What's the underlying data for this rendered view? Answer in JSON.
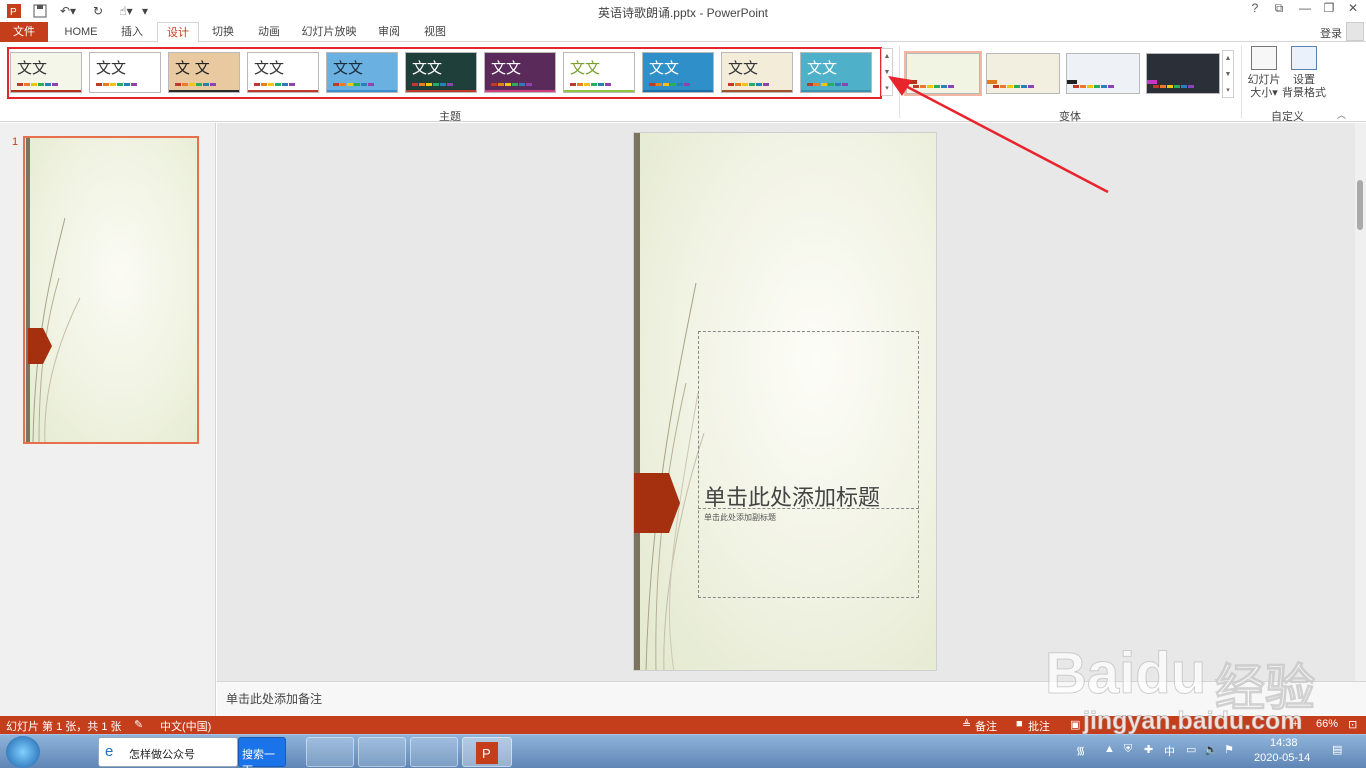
{
  "window": {
    "title": "英语诗歌朗诵.pptx - PowerPoint",
    "help": "?",
    "controls": [
      "?",
      "⧉",
      "—",
      "❐",
      "✕"
    ]
  },
  "quick_access": {
    "save_icon": "save-icon",
    "undo_icon": "undo-icon",
    "redo_icon": "redo-icon",
    "touch_icon": "touch-mode-icon"
  },
  "tabs": {
    "file": "文件",
    "items": [
      "HOME",
      "插入",
      "设计",
      "切换",
      "动画",
      "幻灯片放映",
      "审阅",
      "视图"
    ],
    "active": "设计",
    "login": "登录"
  },
  "ribbon": {
    "themes_group_label": "主题",
    "variants_group_label": "变体",
    "customize_group_label": "自定义",
    "theme_text": "文文",
    "theme_alt_text": "文 文",
    "slide_size_label": "幻灯片大小",
    "slide_size_line1": "幻灯片",
    "slide_size_line2": "大小",
    "bg_format_line1": "设置",
    "bg_format_line2": "背景格式",
    "themes": [
      {
        "bg": "#f4f6ea",
        "fg": "#333333",
        "bar": "#b5321a"
      },
      {
        "bg": "#ffffff",
        "fg": "#333333",
        "bar": "#ffffff"
      },
      {
        "bg": "#e9c9a0",
        "fg": "#222222",
        "bar": "#2b2b2b"
      },
      {
        "bg": "#ffffff",
        "fg": "#333333",
        "bar": "#c0392b"
      },
      {
        "bg": "#6ab0e0",
        "fg": "#1a2b3a",
        "bar": "#3a8fd0"
      },
      {
        "bg": "#1f3f3a",
        "fg": "#ffffff",
        "bar": "#c0392b"
      },
      {
        "bg": "#5a2a5a",
        "fg": "#ffffff",
        "bar": "#d04080"
      },
      {
        "bg": "#ffffff",
        "fg": "#7aa030",
        "bar": "#8ec63f"
      },
      {
        "bg": "#2f8fc8",
        "fg": "#ffffff",
        "bar": "#1c6fa8"
      },
      {
        "bg": "#f3ecd9",
        "fg": "#333333",
        "bar": "#a0522d"
      },
      {
        "bg": "#4fb1c9",
        "fg": "#ffffff",
        "bar": "#3a96ae"
      }
    ],
    "variants": [
      {
        "bg": "#f1f3e3",
        "bar": "#b5321a"
      },
      {
        "bg": "#f3efe0",
        "bar": "#e07a1a"
      },
      {
        "bg": "#eef2f6",
        "bar": "#222222"
      },
      {
        "bg": "#2a2f38",
        "bar": "#cc33cc"
      }
    ]
  },
  "slides_panel": {
    "number": "1"
  },
  "slide": {
    "title_placeholder": "单击此处添加标题",
    "subtitle_placeholder": "单击此处添加副标题"
  },
  "notes": {
    "placeholder": "单击此处添加备注"
  },
  "status": {
    "slide_info": "幻灯片 第 1 张，共 1 张",
    "language": "中文(中国)",
    "notes_btn": "备注",
    "comments_btn": "批注",
    "zoom": "66%"
  },
  "watermark": {
    "brand": "Bai",
    "brand2": "du",
    "cn": "经验",
    "url": "jingyan.baidu.com"
  },
  "taskbar": {
    "ie_label": "怎样做公众号",
    "search_btn": "搜索一下",
    "time": "14:38",
    "date": "2020-05-14",
    "ime": "中"
  },
  "colors": {
    "accent": "#c43e1c",
    "highlight": "#e8242d"
  }
}
